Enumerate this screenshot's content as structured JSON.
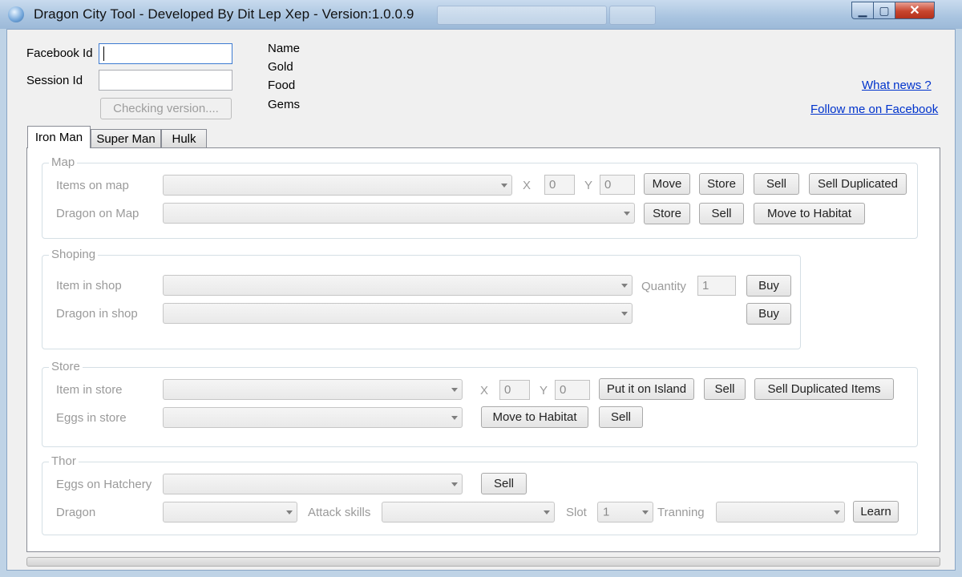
{
  "window": {
    "title": "Dragon City Tool - Developed By Dit Lep Xep - Version:1.0.0.9",
    "controls": {
      "minimize": "▁",
      "maximize": "▢",
      "close": "✕"
    }
  },
  "header": {
    "facebook_id_label": "Facebook Id",
    "facebook_id_value": "",
    "session_id_label": "Session Id",
    "session_id_value": "",
    "check_button": "Checking version....",
    "stats": {
      "name": "Name",
      "gold": "Gold",
      "food": "Food",
      "gems": "Gems"
    },
    "links": {
      "whats_new": "What news ?",
      "follow": "Follow me on Facebook"
    }
  },
  "tabs": [
    "Iron Man",
    "Super Man",
    "Hulk"
  ],
  "map": {
    "title": "Map",
    "items_label": "Items on map",
    "dragon_label": "Dragon on Map",
    "x_label": "X",
    "y_label": "Y",
    "x_value": "0",
    "y_value": "0",
    "buttons": {
      "move": "Move",
      "store": "Store",
      "sell": "Sell",
      "sell_dup": "Sell Duplicated",
      "store2": "Store",
      "sell2": "Sell",
      "move_habitat": "Move to Habitat"
    }
  },
  "shopping": {
    "title": "Shoping",
    "item_label": "Item in shop",
    "dragon_label": "Dragon in shop",
    "quantity_label": "Quantity",
    "quantity_value": "1",
    "buy": "Buy",
    "buy2": "Buy"
  },
  "store": {
    "title": "Store",
    "item_label": "Item in store",
    "eggs_label": "Eggs in store",
    "x_label": "X",
    "y_label": "Y",
    "x_value": "0",
    "y_value": "0",
    "buttons": {
      "put_island": "Put it on Island",
      "sell": "Sell",
      "sell_dup": "Sell Duplicated Items",
      "move_habitat": "Move to Habitat",
      "sell2": "Sell"
    }
  },
  "thor": {
    "title": "Thor",
    "eggs_label": "Eggs on Hatchery",
    "sell": "Sell",
    "dragon_label": "Dragon",
    "attack_label": "Attack skills",
    "slot_label": "Slot",
    "slot_value": "1",
    "training_label": "Tranning",
    "learn": "Learn"
  }
}
